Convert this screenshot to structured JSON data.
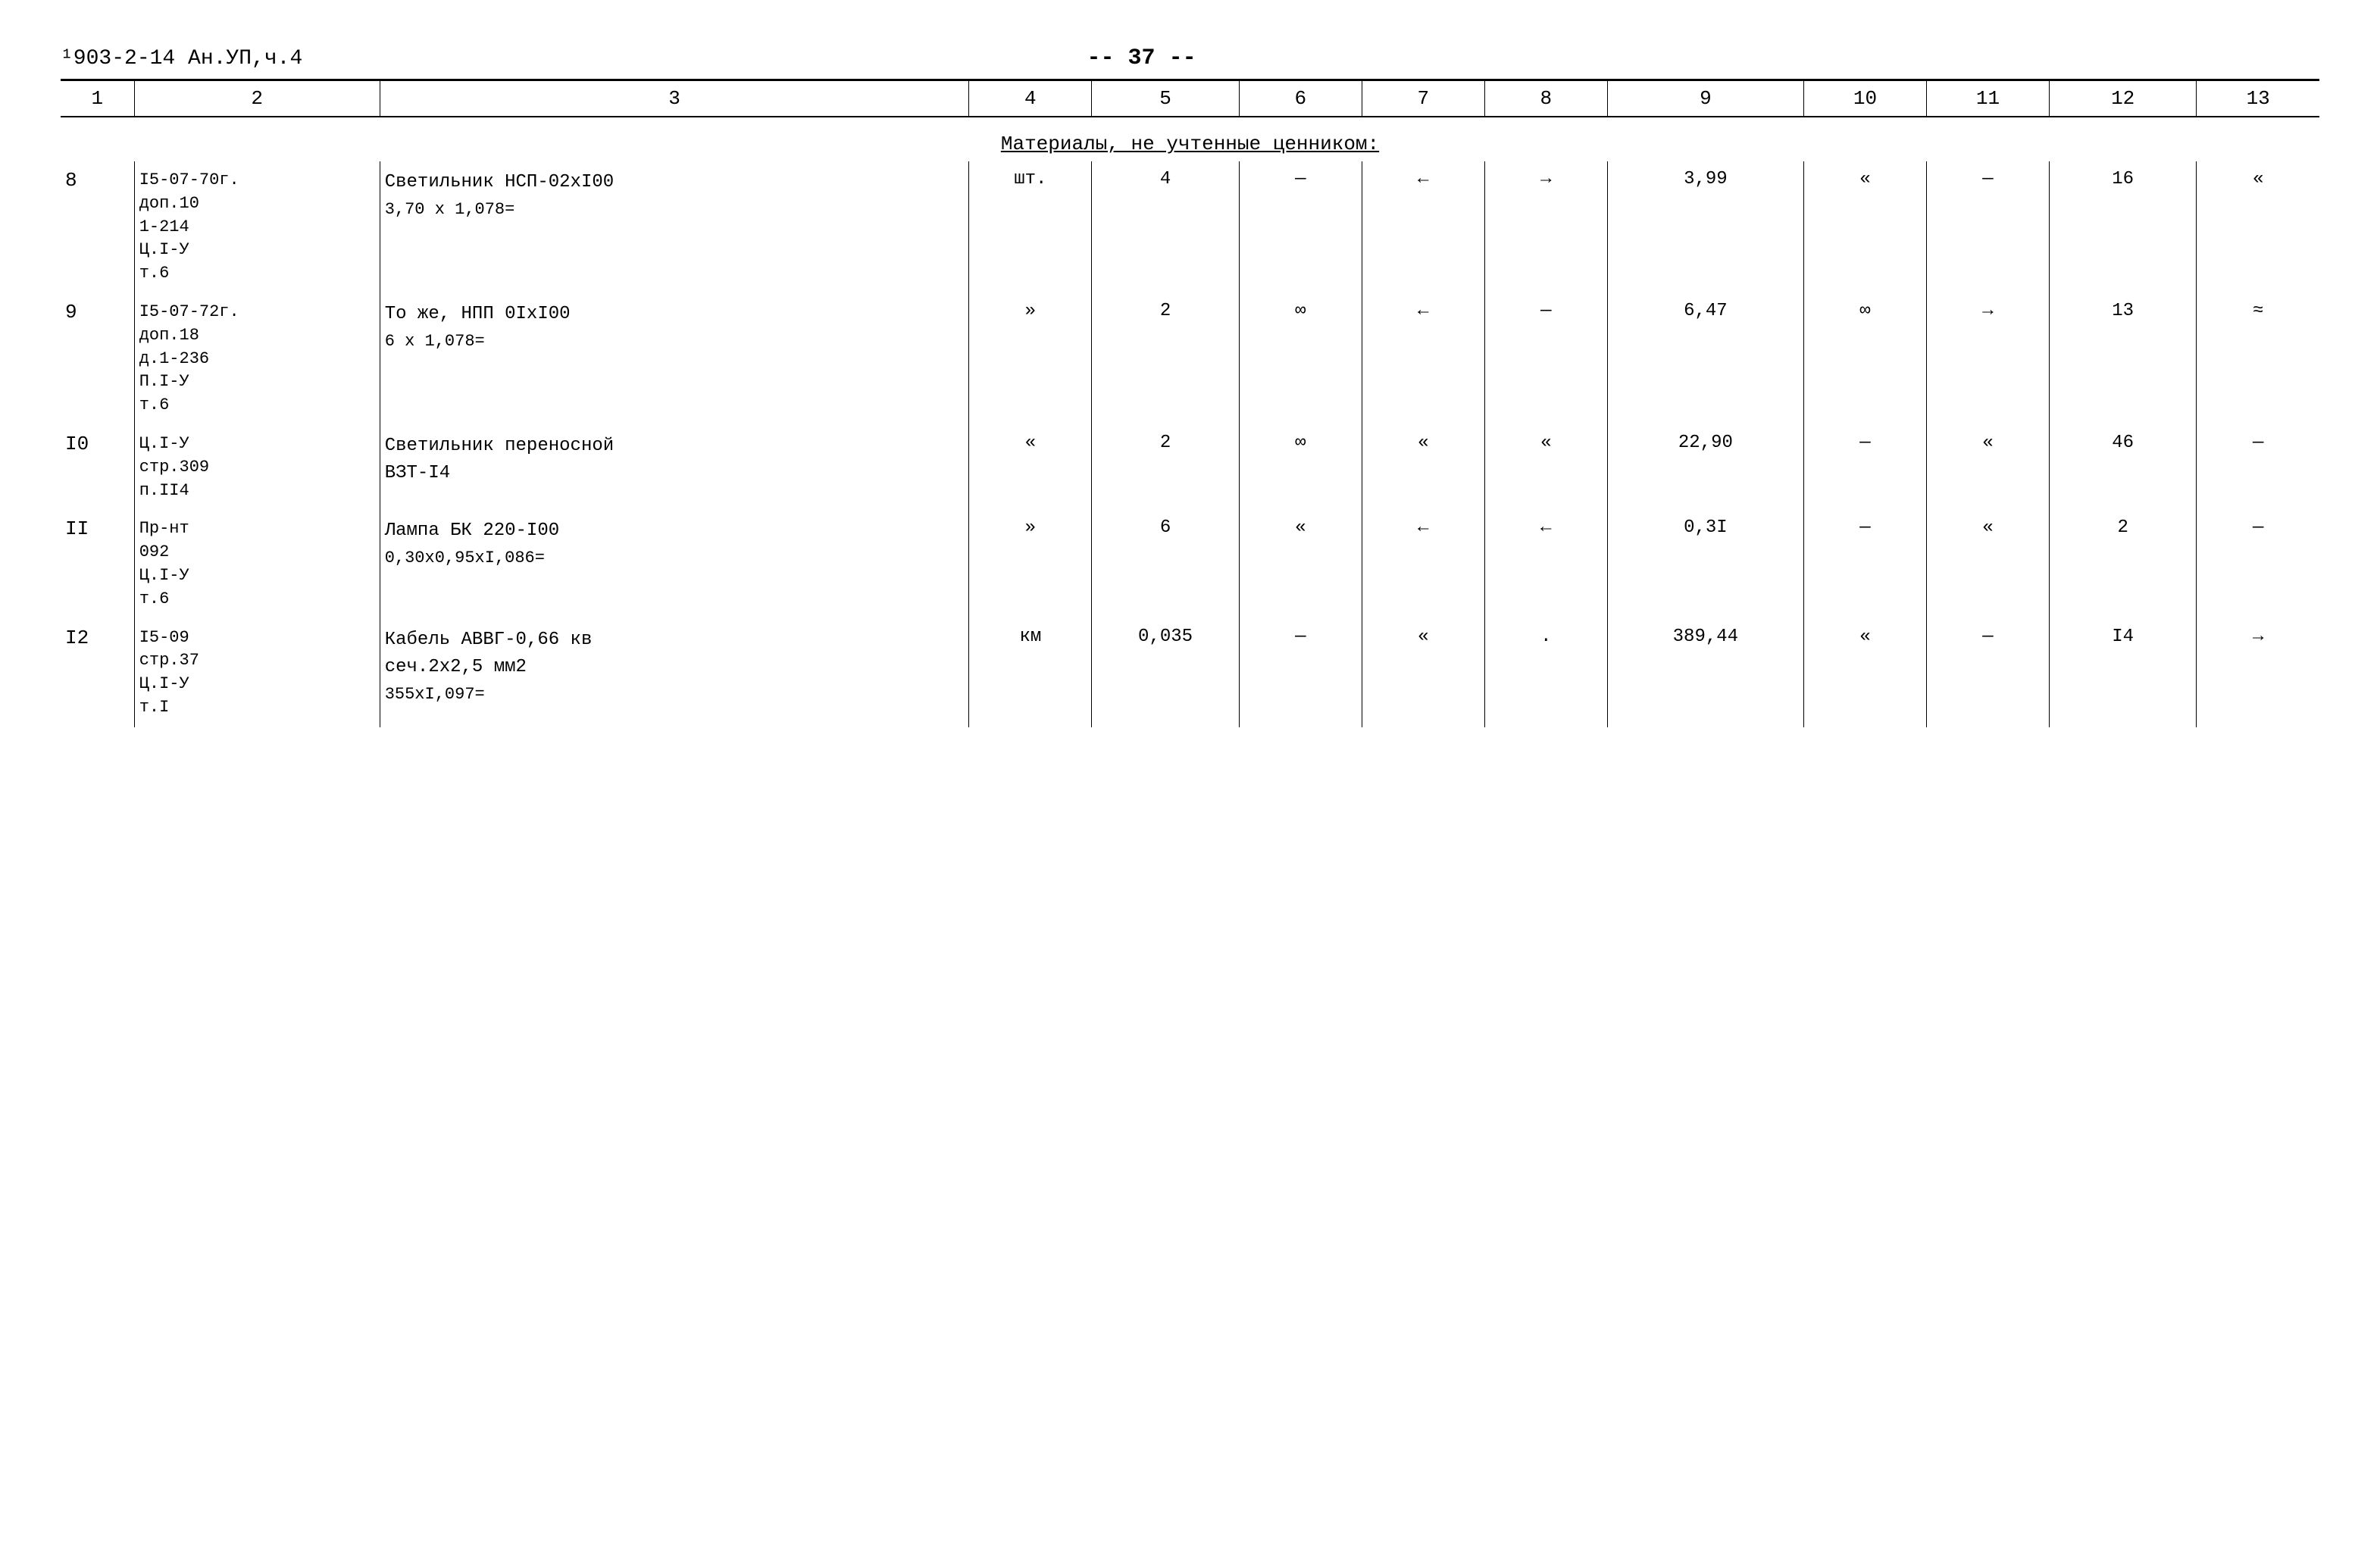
{
  "header": {
    "left": "¹903-2-14   Ан.УП,ч.4",
    "center": "-- 37 --"
  },
  "columns": [
    "1",
    "2",
    "3",
    "4",
    "5",
    "6",
    "7",
    "8",
    "9",
    "10",
    "11",
    "12",
    "13"
  ],
  "section_header": {
    "text": "Материалы, не учтенные ценником:"
  },
  "rows": [
    {
      "num": "8",
      "ref": "I5-07-70г.\nдоп.10\n1-214\nЦ.I-У\nт.6",
      "desc": "Светильник НСП-02хI00\n3,70 x 1,078=",
      "col4": "шт.",
      "col5": "4",
      "col6": "—",
      "col7": "←",
      "col8": "→",
      "col9": "3,99",
      "col10": "«",
      "col11": "—",
      "col12": "16",
      "col13": "«"
    },
    {
      "num": "9",
      "ref": "I5-07-72г.\nдоп.18\nд.1-236\nП.I-У\nт.6",
      "desc": "То же, НПП 0IхI00\n6 x 1,078=",
      "col4": "»",
      "col5": "2",
      "col6": "∞",
      "col7": "←",
      "col8": "—",
      "col9": "6,47",
      "col10": "∞",
      "col11": "→",
      "col12": "13",
      "col13": "≈"
    },
    {
      "num": "I0",
      "ref": "Ц.I-У\nстр.309\nп.II4",
      "desc": "Светильник переносной\nВЗТ-I4",
      "col4": "«",
      "col5": "2",
      "col6": "∞",
      "col7": "«",
      "col8": "«",
      "col9": "22,90",
      "col10": "—",
      "col11": "«",
      "col12": "46",
      "col13": "—"
    },
    {
      "num": "II",
      "ref": "Пр-нт\n092\nЦ.I-У\nт.6",
      "desc": "Лампа БК 220-I00\n0,30х0,95хI,086=",
      "col4": "»",
      "col5": "6",
      "col6": "«",
      "col7": "←",
      "col8": "←",
      "col9": "0,3I",
      "col10": "—",
      "col11": "«",
      "col12": "2",
      "col13": "—"
    },
    {
      "num": "I2",
      "ref": "I5-09\nстр.37\nЦ.I-У\nт.I",
      "desc": "Кабель АВВГ-0,66 кв\nсеч.2х2,5 мм2\n355хI,097=",
      "col4": "км",
      "col5": "0,035",
      "col6": "—",
      "col7": "«",
      "col8": ".",
      "col9": "389,44",
      "col10": "«",
      "col11": "—",
      "col12": "I4",
      "col13": "→"
    }
  ]
}
